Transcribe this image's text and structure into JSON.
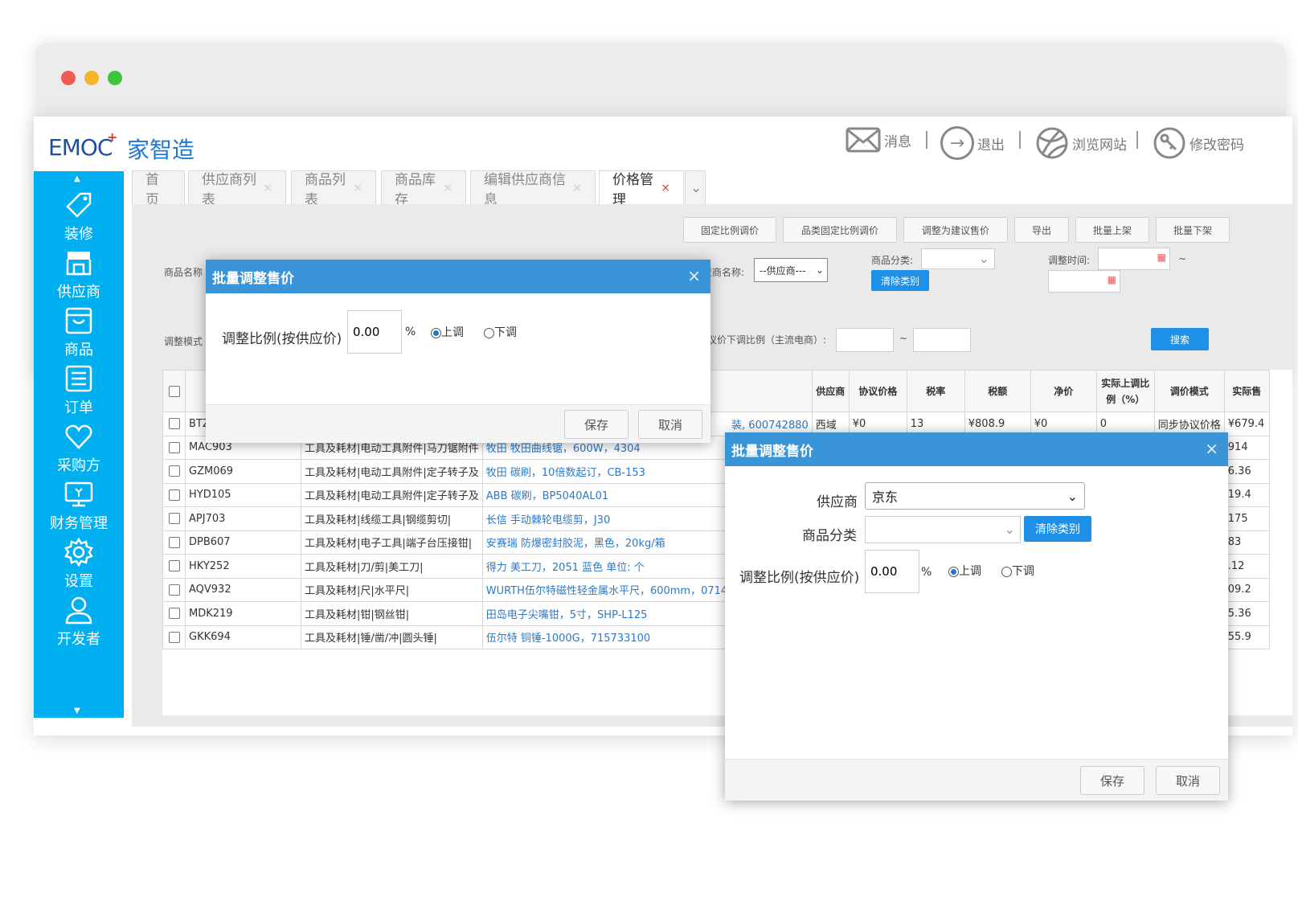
{
  "brand": {
    "logo_text": "EMOC",
    "logo_plus": "+",
    "name_cn": "家智造"
  },
  "header_nav": [
    {
      "label": "消息",
      "icon": "mail-icon"
    },
    {
      "label": "退出",
      "icon": "logout-icon"
    },
    {
      "label": "浏览网站",
      "icon": "globe-icon"
    },
    {
      "label": "修改密码",
      "icon": "key-icon"
    }
  ],
  "sidebar": [
    {
      "label": "装修"
    },
    {
      "label": "供应商"
    },
    {
      "label": "商品"
    },
    {
      "label": "订单"
    },
    {
      "label": "采购方"
    },
    {
      "label": "财务管理"
    },
    {
      "label": "设置"
    },
    {
      "label": "开发者"
    }
  ],
  "tabs": [
    {
      "label": "首页"
    },
    {
      "label": "供应商列表"
    },
    {
      "label": "商品列表"
    },
    {
      "label": "商品库存"
    },
    {
      "label": "编辑供应商信息"
    },
    {
      "label": "价格管理"
    }
  ],
  "tab_close": "×",
  "toolbar": [
    "固定比例调价",
    "品类固定比例调价",
    "调整为建议售价",
    "导出",
    "批量上架",
    "批量下架"
  ],
  "filters": {
    "product_name_label": "商品名称",
    "supplier_name_label": "应商名称:",
    "supplier_select": "--供应商---",
    "category_label": "商品分类:",
    "clear_category": "清除类别",
    "adjust_time_label": "调整时间:",
    "tilde": "~",
    "adjust_mode_label": "调整模式",
    "down_ratio_label": "议价下调比例（主流电商）:",
    "search": "搜索"
  },
  "grid": {
    "headers": [
      "供应商",
      "协议价格",
      "税率",
      "税额",
      "净价",
      "实际上调比例（%）",
      "调价模式",
      "实际售"
    ],
    "first_row": {
      "code": "BTZ",
      "desc_tail": "装, 600742880",
      "supplier": "西域",
      "agreement_price": "¥0",
      "tax_rate": "13",
      "tax_amount": "¥808.9",
      "net": "¥0",
      "ratio": "0",
      "mode": "同步协议价格",
      "actual": "¥679.4"
    },
    "rows": [
      {
        "code": "MAC903",
        "category": "工具及耗材|电动工具附件|马刀锯附件",
        "name": "牧田 牧田曲线锯，600W，4304",
        "tail": "914"
      },
      {
        "code": "GZM069",
        "category": "工具及耗材|电动工具附件|定子转子及",
        "name": "牧田 碳刷，10倍数起订，CB-153",
        "tail": "6.36"
      },
      {
        "code": "HYD105",
        "category": "工具及耗材|电动工具附件|定子转子及",
        "name": "ABB 碳刷，BP5040AL01",
        "tail": "19.4"
      },
      {
        "code": "APJ703",
        "category": "工具及耗材|线缆工具|钢缆剪切|",
        "name": "长信 手动棘轮电缆剪，J30",
        "tail": "175"
      },
      {
        "code": "DPB607",
        "category": "工具及耗材|电子工具|端子台压接钳|",
        "name": "安赛瑞 防爆密封胶泥，黑色，20kg/箱",
        "tail": "83"
      },
      {
        "code": "HKY252",
        "category": "工具及耗材|刀/剪|美工刀|",
        "name": "得力 美工刀，2051 蓝色 单位: 个",
        "tail": ".12"
      },
      {
        "code": "AQV932",
        "category": "工具及耗材|尺|水平尺|",
        "name": "WURTH伍尔特磁性轻金属水平尺，600mm，071464430",
        "tail": "09.2"
      },
      {
        "code": "MDK219",
        "category": "工具及耗材|钳|钢丝钳|",
        "name": "田岛电子尖嘴钳，5寸，SHP-L125",
        "tail": "5.36"
      },
      {
        "code": "GKK694",
        "category": "工具及耗材|锤/凿/冲|圆头锤|",
        "name": "伍尔特 铜锤-1000G，715733100",
        "tail": "55.9"
      }
    ]
  },
  "dialog1": {
    "title": "批量调整售价",
    "close": "×",
    "ratio_label": "调整比例(按供应价)",
    "ratio_value": "0.00",
    "percent": "%",
    "up": "上调",
    "down": "下调",
    "save": "保存",
    "cancel": "取消"
  },
  "dialog2": {
    "title": "批量调整售价",
    "close": "×",
    "supplier_label": "供应商",
    "supplier_value": "京东",
    "category_label": "商品分类",
    "clear_category": "清除类别",
    "ratio_label": "调整比例(按供应价)",
    "ratio_value": "0.00",
    "percent": "%",
    "up": "上调",
    "down": "下调",
    "save": "保存",
    "cancel": "取消"
  }
}
